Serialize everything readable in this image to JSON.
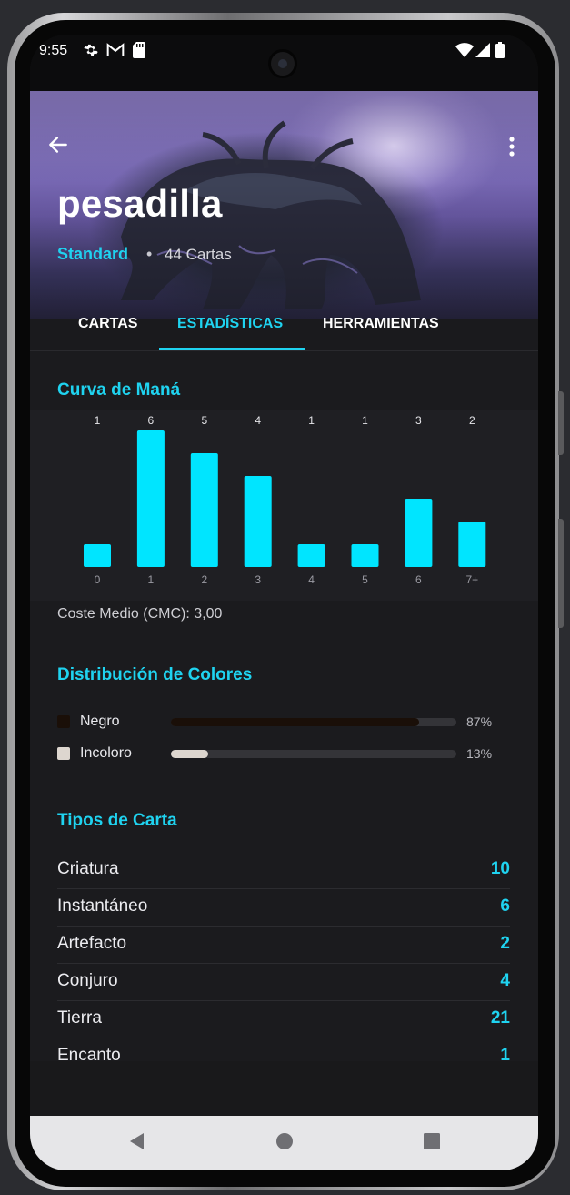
{
  "status_bar": {
    "time": "9:55",
    "icons": [
      "gear-icon",
      "gmail-icon",
      "sd-card-icon",
      "wifi-icon",
      "signal-icon",
      "battery-icon"
    ]
  },
  "header": {
    "deck_name": "pesadilla",
    "format": "Standard",
    "separator": "•",
    "card_count": "44 Cartas"
  },
  "tabs": [
    {
      "label": "CARTAS",
      "active": false
    },
    {
      "label": "ESTADÍSTICAS",
      "active": true
    },
    {
      "label": "HERRAMIENTAS",
      "active": false
    }
  ],
  "mana_curve": {
    "title": "Curva de Maná",
    "average_label": "Coste Medio (CMC): 3,00"
  },
  "chart_data": {
    "type": "bar",
    "categories": [
      "0",
      "1",
      "2",
      "3",
      "4",
      "5",
      "6",
      "7+"
    ],
    "values": [
      1,
      6,
      5,
      4,
      1,
      1,
      3,
      2
    ],
    "title": "",
    "xlabel": "",
    "ylabel": "",
    "ylim": [
      0,
      6
    ],
    "grid": false,
    "bar_color": "#00e5ff"
  },
  "colors_section": {
    "title": "Distribución de Colores",
    "items": [
      {
        "name": "Negro",
        "percent_label": "87%",
        "fraction": 0.87,
        "color": "#1a0f08"
      },
      {
        "name": "Incoloro",
        "percent_label": "13%",
        "fraction": 0.13,
        "color": "#ddd6cf"
      }
    ]
  },
  "types_section": {
    "title": "Tipos de Carta",
    "items": [
      {
        "name": "Criatura",
        "count": "10"
      },
      {
        "name": "Instantáneo",
        "count": "6"
      },
      {
        "name": "Artefacto",
        "count": "2"
      },
      {
        "name": "Conjuro",
        "count": "4"
      },
      {
        "name": "Tierra",
        "count": "21"
      },
      {
        "name": "Encanto",
        "count": "1"
      }
    ]
  },
  "accent_color": "#1fd3f0"
}
